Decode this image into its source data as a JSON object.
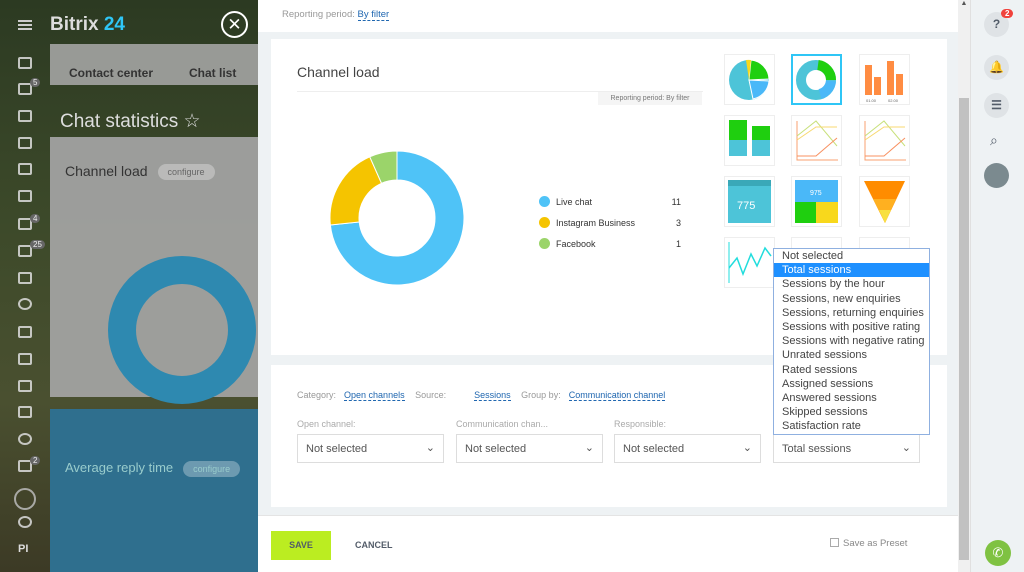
{
  "background": {
    "logo_main": "Bitrix",
    "logo_accent": "24",
    "tabs": [
      "Contact center",
      "Chat list"
    ],
    "page_title": "Chat statistics",
    "card1_title": "Channel load",
    "card2_title": "Average reply time",
    "configure": "configure",
    "nav_badges": [
      "5",
      "4",
      "25",
      "2"
    ],
    "nav_bottom": "PI"
  },
  "panel": {
    "reporting_label": "Reporting period:",
    "reporting_value": "By filter",
    "widget_title": "Channel load",
    "widget_period": "Reporting period: By filter",
    "chart_data": {
      "type": "pie",
      "donut": true,
      "categories": [
        "Live chat",
        "Instagram Business",
        "Facebook"
      ],
      "values": [
        11,
        3,
        1
      ],
      "colors": [
        "#4fc3f7",
        "#f5c400",
        "#9bd46a"
      ]
    },
    "filters": {
      "category_label": "Category:",
      "category": "Open channels",
      "source_label": "Source:",
      "source": "Sessions",
      "group_label": "Group by:",
      "group": "Communication channel"
    },
    "selects": [
      {
        "label": "Open channel:",
        "value": "Not selected"
      },
      {
        "label": "Communication chan...",
        "value": "Not selected"
      },
      {
        "label": "Responsible:",
        "value": "Not selected"
      },
      {
        "label": "",
        "value": "Total sessions"
      }
    ],
    "dropdown": {
      "options": [
        "Not selected",
        "Total sessions",
        "Sessions by the hour",
        "Sessions, new enquiries",
        "Sessions, returning enquiries",
        "Sessions with positive rating",
        "Sessions with negative rating",
        "Unrated sessions",
        "Rated sessions",
        "Assigned sessions",
        "Answered sessions",
        "Skipped sessions",
        "Satisfaction rate"
      ],
      "highlighted": "Total sessions"
    },
    "thumbnails": [
      "pie",
      "donut",
      "bar",
      "stacked-bar",
      "line",
      "line-2",
      "number",
      "number-block",
      "funnel",
      "line-teal",
      "table",
      "table-2"
    ],
    "thumb_text": {
      "bar_ticks": [
        "01.00",
        "02.00"
      ],
      "number": "775",
      "number_block": "975"
    },
    "footer": {
      "save": "SAVE",
      "cancel": "CANCEL",
      "preset": "Save as Preset"
    }
  },
  "right_bar": {
    "help_badge": "2"
  },
  "colors": {
    "accent": "#2fc6f6",
    "save": "#bbed21",
    "link": "#2067b0"
  }
}
